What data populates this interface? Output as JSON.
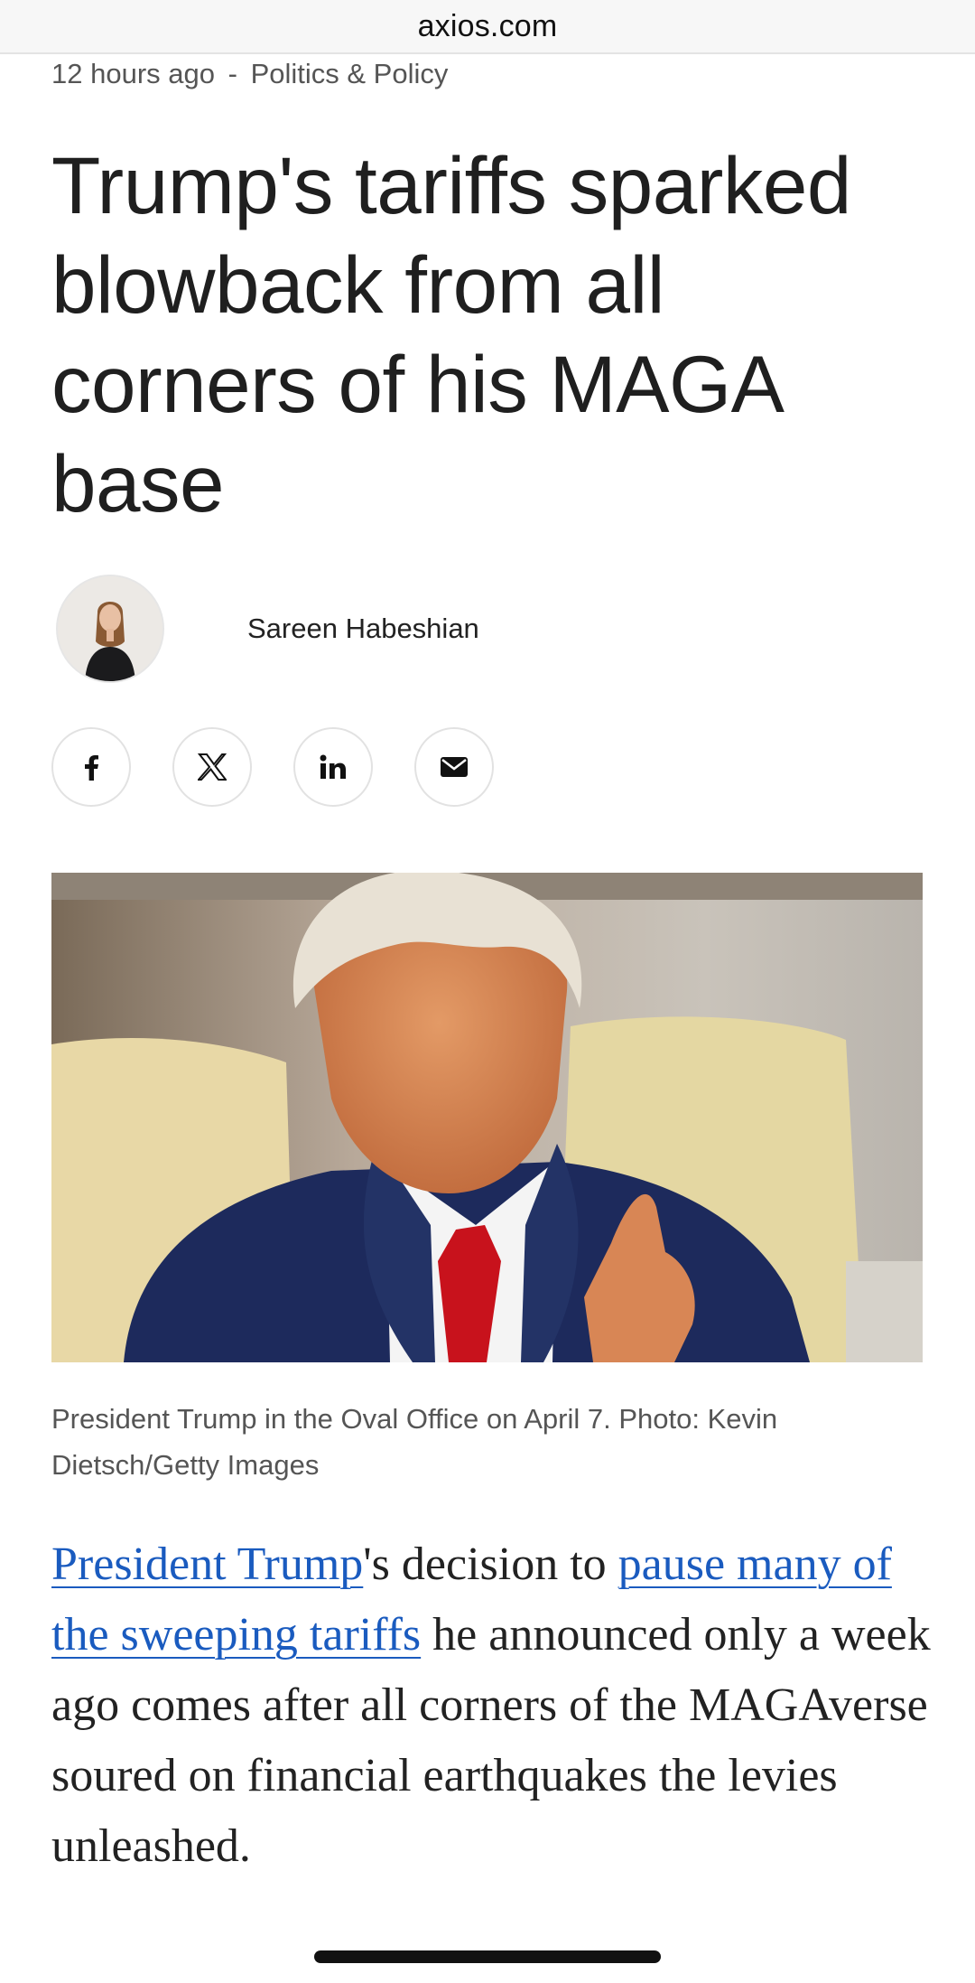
{
  "browser": {
    "domain": "axios.com"
  },
  "article": {
    "time": "12 hours ago",
    "separator": "-",
    "section": "Politics & Policy",
    "headline": "Trump's tariffs sparked blowback from all corners of his MAGA base",
    "author": "Sareen Habeshian",
    "share": [
      {
        "name": "facebook-share-button",
        "icon": "facebook-icon"
      },
      {
        "name": "x-share-button",
        "icon": "x-icon"
      },
      {
        "name": "linkedin-share-button",
        "icon": "linkedin-icon"
      },
      {
        "name": "email-share-button",
        "icon": "mail-icon"
      }
    ],
    "caption": "President Trump in the Oval Office on April 7. Photo: Kevin Dietsch/Getty Images",
    "body": {
      "link1": "President Trump",
      "text1": "'s decision to ",
      "link2": "pause many of the sweeping tariffs",
      "text2": " he announced only a week ago comes after all corners of the MAGAverse soured on financial earthquakes the levies unleashed."
    }
  },
  "colors": {
    "link": "#1a5bbf",
    "text": "#222222",
    "muted": "#555555"
  }
}
